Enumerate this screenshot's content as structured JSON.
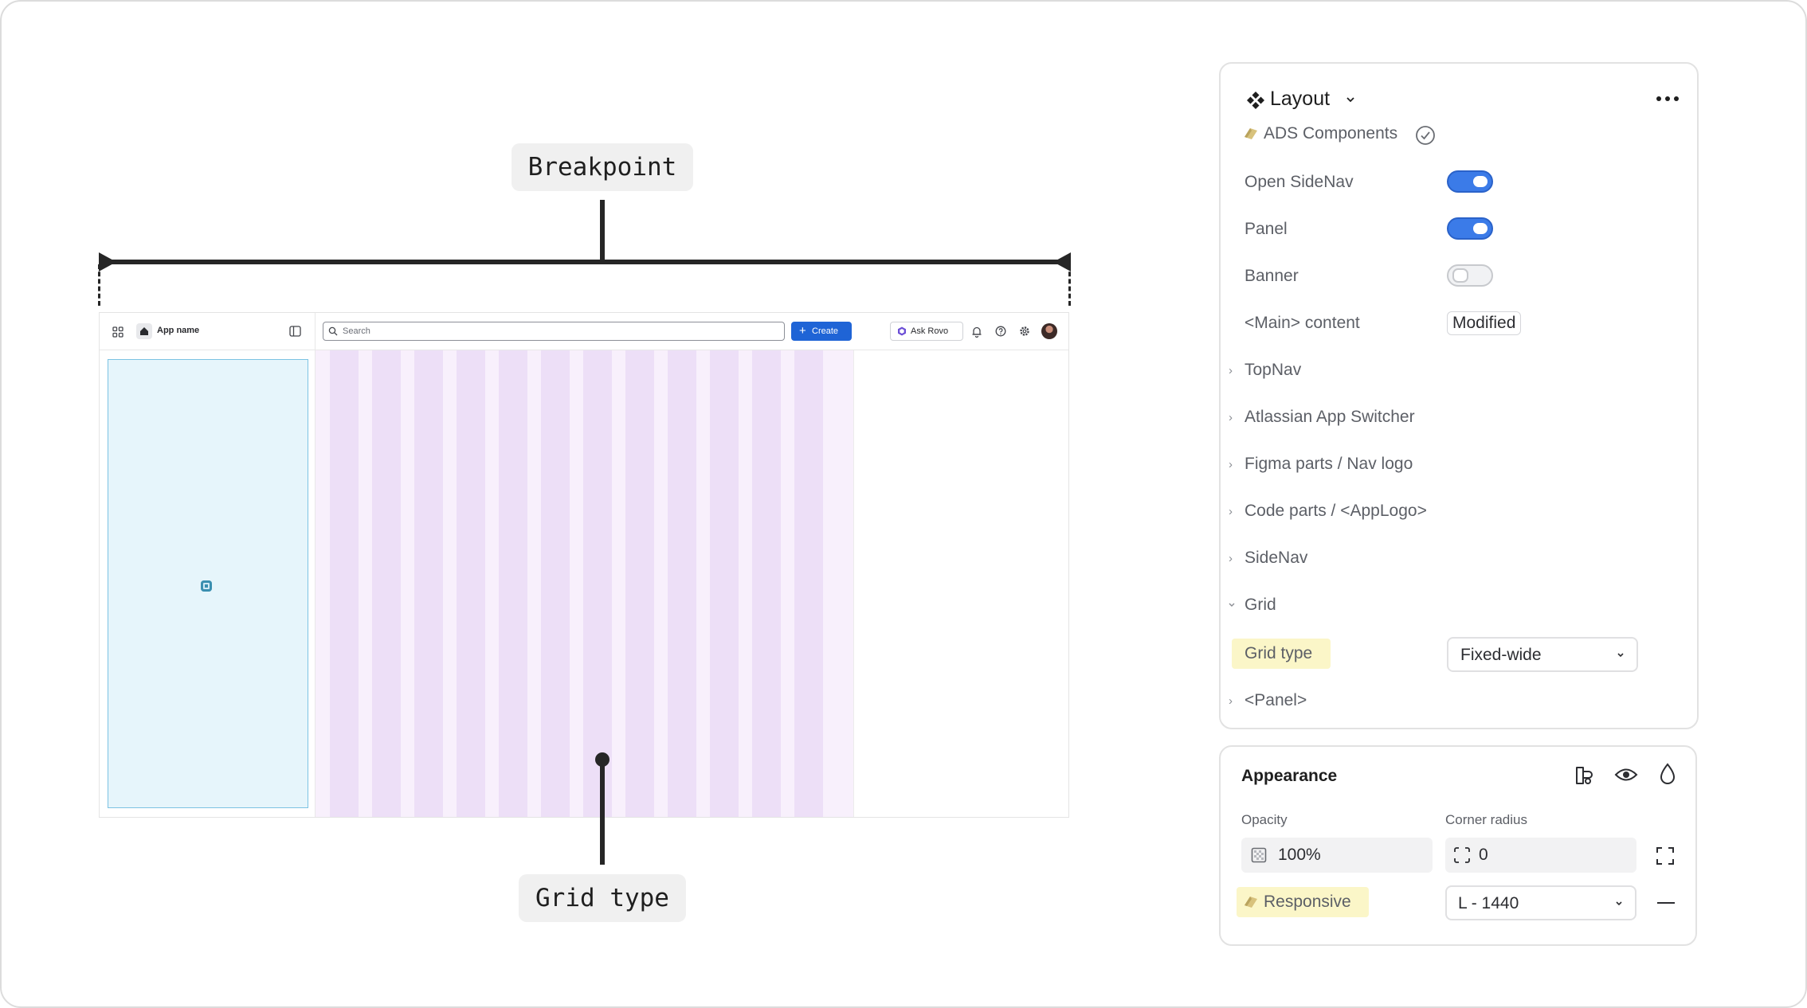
{
  "annotations": {
    "breakpoint_label": "Breakpoint",
    "grid_type_label": "Grid type"
  },
  "mock_app": {
    "app_name": "App name",
    "search_placeholder": "Search",
    "create_label": "Create",
    "ask_rovo_label": "Ask Rovo",
    "grid_column_count": 12
  },
  "layout_panel": {
    "title": "Layout",
    "library": "ADS Components",
    "properties": [
      {
        "label": "Open SideNav",
        "type": "toggle",
        "value": true
      },
      {
        "label": "Panel",
        "type": "toggle",
        "value": true
      },
      {
        "label": "Banner",
        "type": "toggle",
        "value": false
      },
      {
        "label": "<Main> content",
        "type": "badge",
        "value": "Modified"
      }
    ],
    "sections": [
      "TopNav",
      "Atlassian App Switcher",
      "Figma parts / Nav logo",
      "Code parts / <AppLogo>",
      "SideNav"
    ],
    "grid_section": "Grid",
    "grid_type_label": "Grid type",
    "grid_type_value": "Fixed-wide",
    "panel_section": "<Panel>"
  },
  "appearance_panel": {
    "title": "Appearance",
    "opacity_label": "Opacity",
    "opacity_value": "100%",
    "corner_radius_label": "Corner radius",
    "corner_radius_value": "0",
    "responsive_label": "Responsive",
    "responsive_value": "L - 1440"
  },
  "colors": {
    "toggle_on": "#3b7be8",
    "grid_column": "#eddff7",
    "sidenav_fill": "#e6f5fb",
    "highlight": "#fbf6c8",
    "create_button": "#1f64d6"
  }
}
